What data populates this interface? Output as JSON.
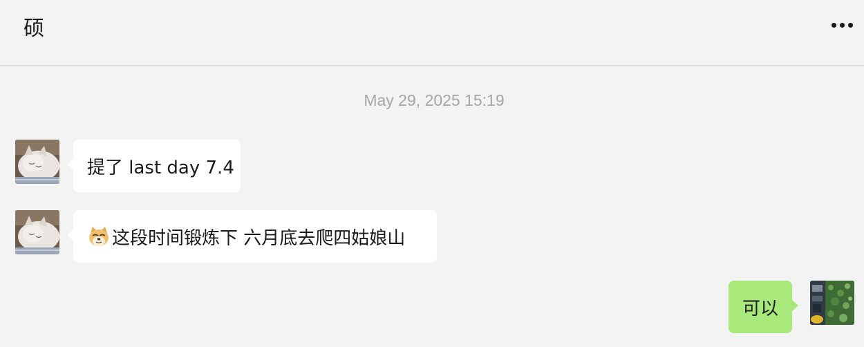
{
  "header": {
    "title": "硕",
    "more_icon": "more-horizontal-icon"
  },
  "timestamp": "May 29, 2025 15:19",
  "messages": [
    {
      "direction": "incoming",
      "avatar": "cat-avatar",
      "text": "提了 last day 7.4"
    },
    {
      "direction": "incoming",
      "avatar": "cat-avatar",
      "emoji": "doge-emoji",
      "text": "这段时间锻炼下 六月底去爬四姑娘山"
    },
    {
      "direction": "outgoing",
      "avatar": "self-avatar",
      "text": "可以"
    }
  ],
  "colors": {
    "background": "#f3f3f3",
    "incoming_bubble": "#ffffff",
    "outgoing_bubble": "#a9e97b",
    "timestamp": "#a6a6a6"
  }
}
